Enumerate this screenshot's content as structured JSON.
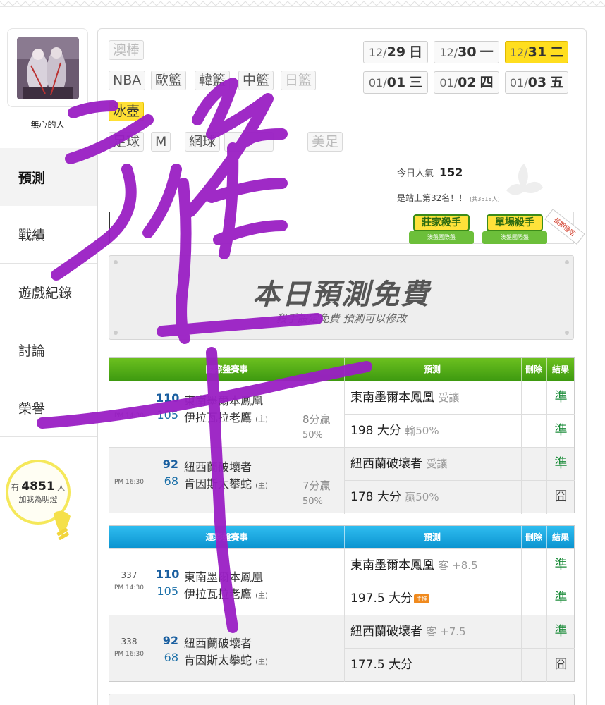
{
  "profile": {
    "username": "無心的人"
  },
  "side_nav": [
    "預測",
    "戰績",
    "遊戲紀錄",
    "討論",
    "榮譽"
  ],
  "light": {
    "prefix": "有",
    "count": "4851",
    "suffix": "人",
    "text": "加我為明燈"
  },
  "sports_tags": {
    "row1": [
      "澳棒"
    ],
    "row2": [
      "NBA",
      "歐籃",
      "韓籃",
      "中籃",
      "日籃"
    ],
    "row3": [
      "冰壺"
    ],
    "row4": [
      "足球",
      "M",
      "網球",
      "",
      "美足"
    ]
  },
  "dates": [
    {
      "month": "12/",
      "day": "29",
      "weekday": "日"
    },
    {
      "month": "12/",
      "day": "30",
      "weekday": "一"
    },
    {
      "month": "12/",
      "day": "31",
      "weekday": "二"
    },
    {
      "month": "01/",
      "day": "01",
      "weekday": "三"
    },
    {
      "month": "01/",
      "day": "02",
      "weekday": "四"
    },
    {
      "month": "01/",
      "day": "03",
      "weekday": "五"
    }
  ],
  "stats": {
    "popularity_label": "今日人氣",
    "popularity_value": "152",
    "rank_text": "是站上第32名！！",
    "rank_total": "(共3518人)"
  },
  "badges": [
    {
      "title": "莊家殺手",
      "sub": "澳盤國際盤"
    },
    {
      "title": "單場殺手",
      "sub": "澳盤國際盤"
    }
  ],
  "long_ribbon": "長期穩定",
  "free_banner": {
    "title": "本日預測免費",
    "subtitle": "殺手設定免費 預測可以修改"
  },
  "table1": {
    "headers": {
      "match": "國際盤賽事",
      "prediction": "預測",
      "delete": "刪除",
      "result": "結果"
    },
    "matches": [
      {
        "num": "",
        "time": "PM 14:30",
        "away_score": "110",
        "away_team": "東南墨爾本鳳凰",
        "home_score": "105",
        "home_team": "伊拉瓦拉老鷹",
        "home_mark": "(主)",
        "handicap": "8分贏",
        "handicap_pct": "50%",
        "preds": [
          {
            "main": "東南墨爾本鳳凰",
            "note": "受讓",
            "result": "準"
          },
          {
            "main": "198 大分",
            "note": "輸50%",
            "result": "準"
          }
        ]
      },
      {
        "num": "",
        "time": "PM 16:30",
        "away_score": "92",
        "away_team": "紐西蘭破壞者",
        "home_score": "68",
        "home_team": "肯因斯太攀蛇",
        "home_mark": "(主)",
        "handicap": "7分贏",
        "handicap_pct": "50%",
        "preds": [
          {
            "main": "紐西蘭破壞者",
            "note": "受讓",
            "result": "準"
          },
          {
            "main": "178 大分",
            "note": "贏50%",
            "result": "囧"
          }
        ]
      }
    ]
  },
  "table2": {
    "headers": {
      "match": "運彩盤賽事",
      "prediction": "預測",
      "delete": "刪除",
      "result": "結果"
    },
    "matches": [
      {
        "num": "337",
        "time": "PM 14:30",
        "away_score": "110",
        "away_team": "東南墨爾本鳳凰",
        "home_score": "105",
        "home_team": "伊拉瓦拉老鷹",
        "home_mark": "(主)",
        "preds": [
          {
            "main": "東南墨爾本鳳凰",
            "note": "客 +8.5",
            "result": "準"
          },
          {
            "main": "197.5 大分",
            "note": "",
            "tag": "主推",
            "result": "準"
          }
        ]
      },
      {
        "num": "338",
        "time": "PM 16:30",
        "away_score": "92",
        "away_team": "紐西蘭破壞者",
        "home_score": "68",
        "home_team": "肯因斯太攀蛇",
        "home_mark": "(主)",
        "preds": [
          {
            "main": "紐西蘭破壞者",
            "note": "客 +7.5",
            "result": "準"
          },
          {
            "main": "177.5 大分",
            "note": "",
            "result": "囧"
          }
        ]
      }
    ]
  },
  "colors": {
    "accent_yellow": "#ffde1f",
    "green_header": "#4aa815",
    "blue_header": "#17a6de",
    "result_green": "#1e8d3c",
    "scribble": "#9a1fc4"
  }
}
